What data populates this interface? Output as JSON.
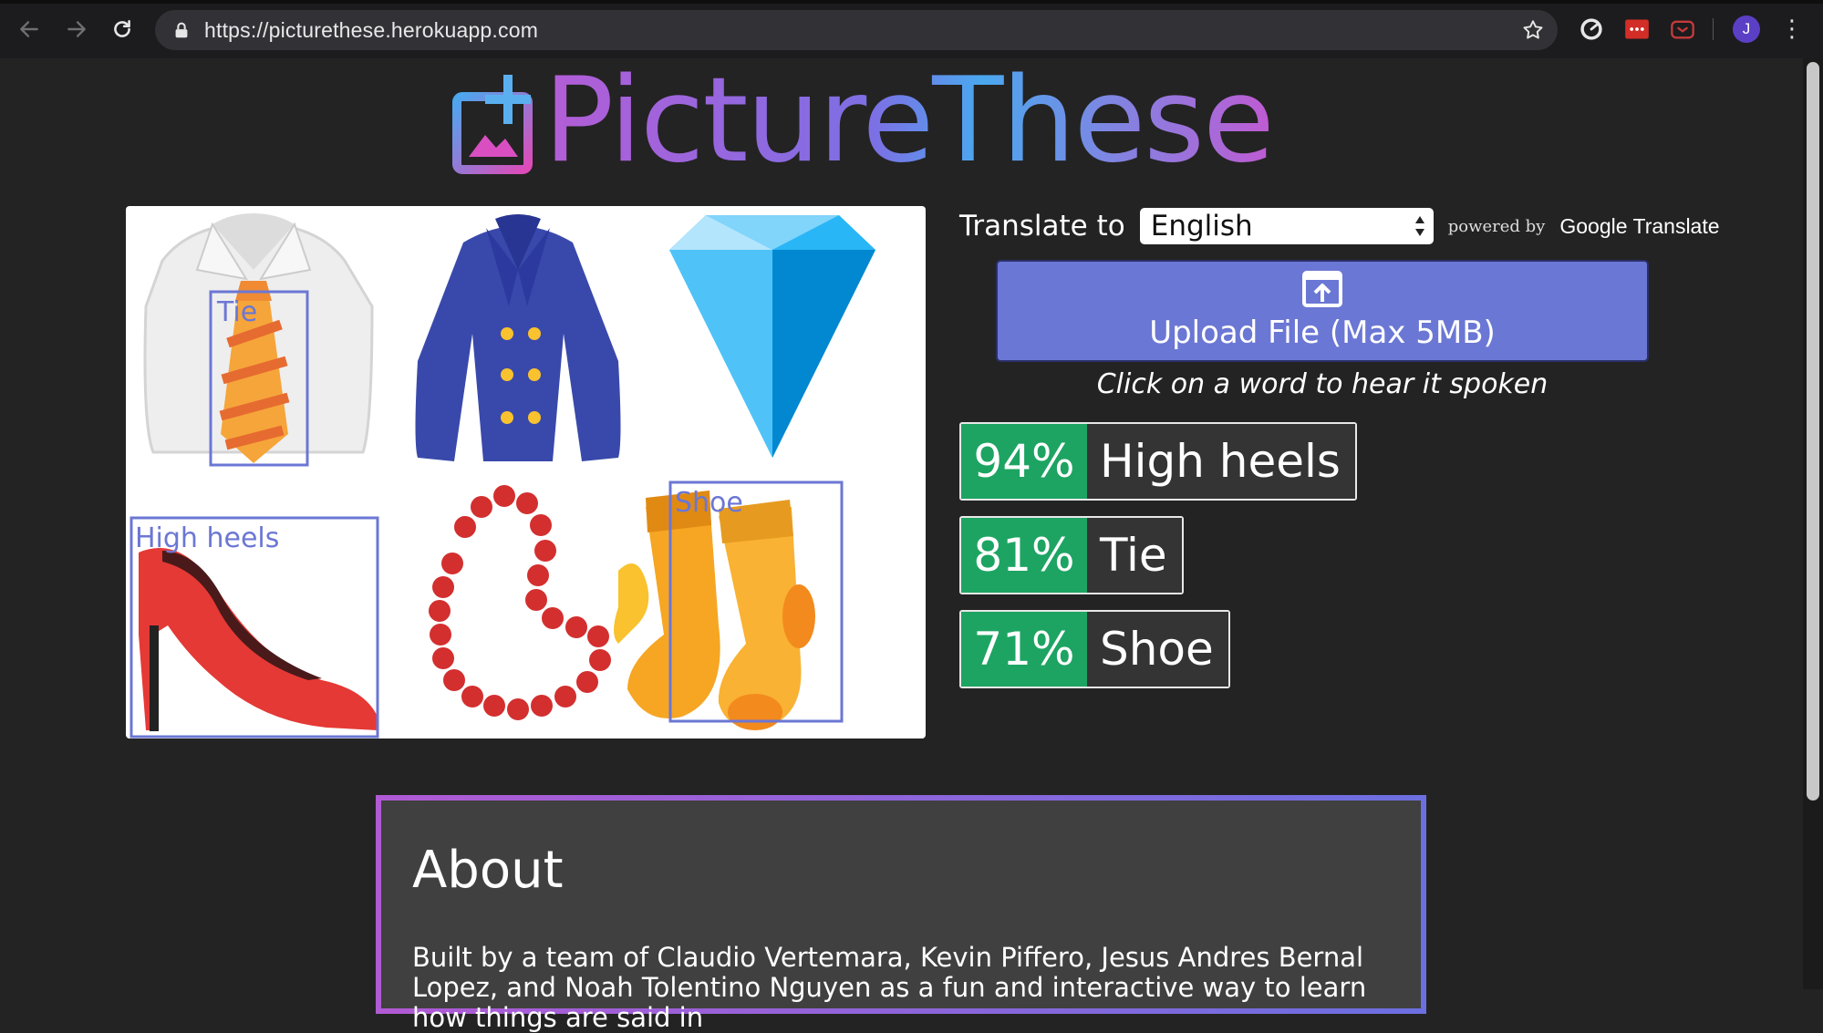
{
  "browser": {
    "url": "https://picturethese.herokuapp.com",
    "profile_initial": "J",
    "icons": [
      "back-icon",
      "forward-icon",
      "reload-icon",
      "lock-icon",
      "bookmark-star-icon",
      "extension-icon",
      "profile-avatar",
      "menu-kebab-icon"
    ]
  },
  "app": {
    "title": "PictureThese"
  },
  "image": {
    "detections": [
      {
        "label": "Tie"
      },
      {
        "label": "High heels"
      },
      {
        "label": "Shoe"
      }
    ]
  },
  "translate": {
    "label": "Translate to",
    "selected_language": "English",
    "powered_by": "powered by",
    "provider": "Google Translate"
  },
  "upload": {
    "label": "Upload File (Max 5MB)"
  },
  "hint": "Click on a word to hear it spoken",
  "results": [
    {
      "percent": "94%",
      "word": "High heels"
    },
    {
      "percent": "81%",
      "word": "Tie"
    },
    {
      "percent": "71%",
      "word": "Shoe"
    }
  ],
  "about": {
    "heading": "About",
    "text": "Built by a team of Claudio Vertemara, Kevin Piffero, Jesus Andres Bernal Lopez, and Noah Tolentino Nguyen as a fun and interactive way to learn how things are said in"
  },
  "colors": {
    "page_bg": "#232323",
    "accent_blue": "#6b77d4",
    "confidence_green": "#1da462",
    "word_bg": "#343434",
    "about_bg": "#404040"
  }
}
